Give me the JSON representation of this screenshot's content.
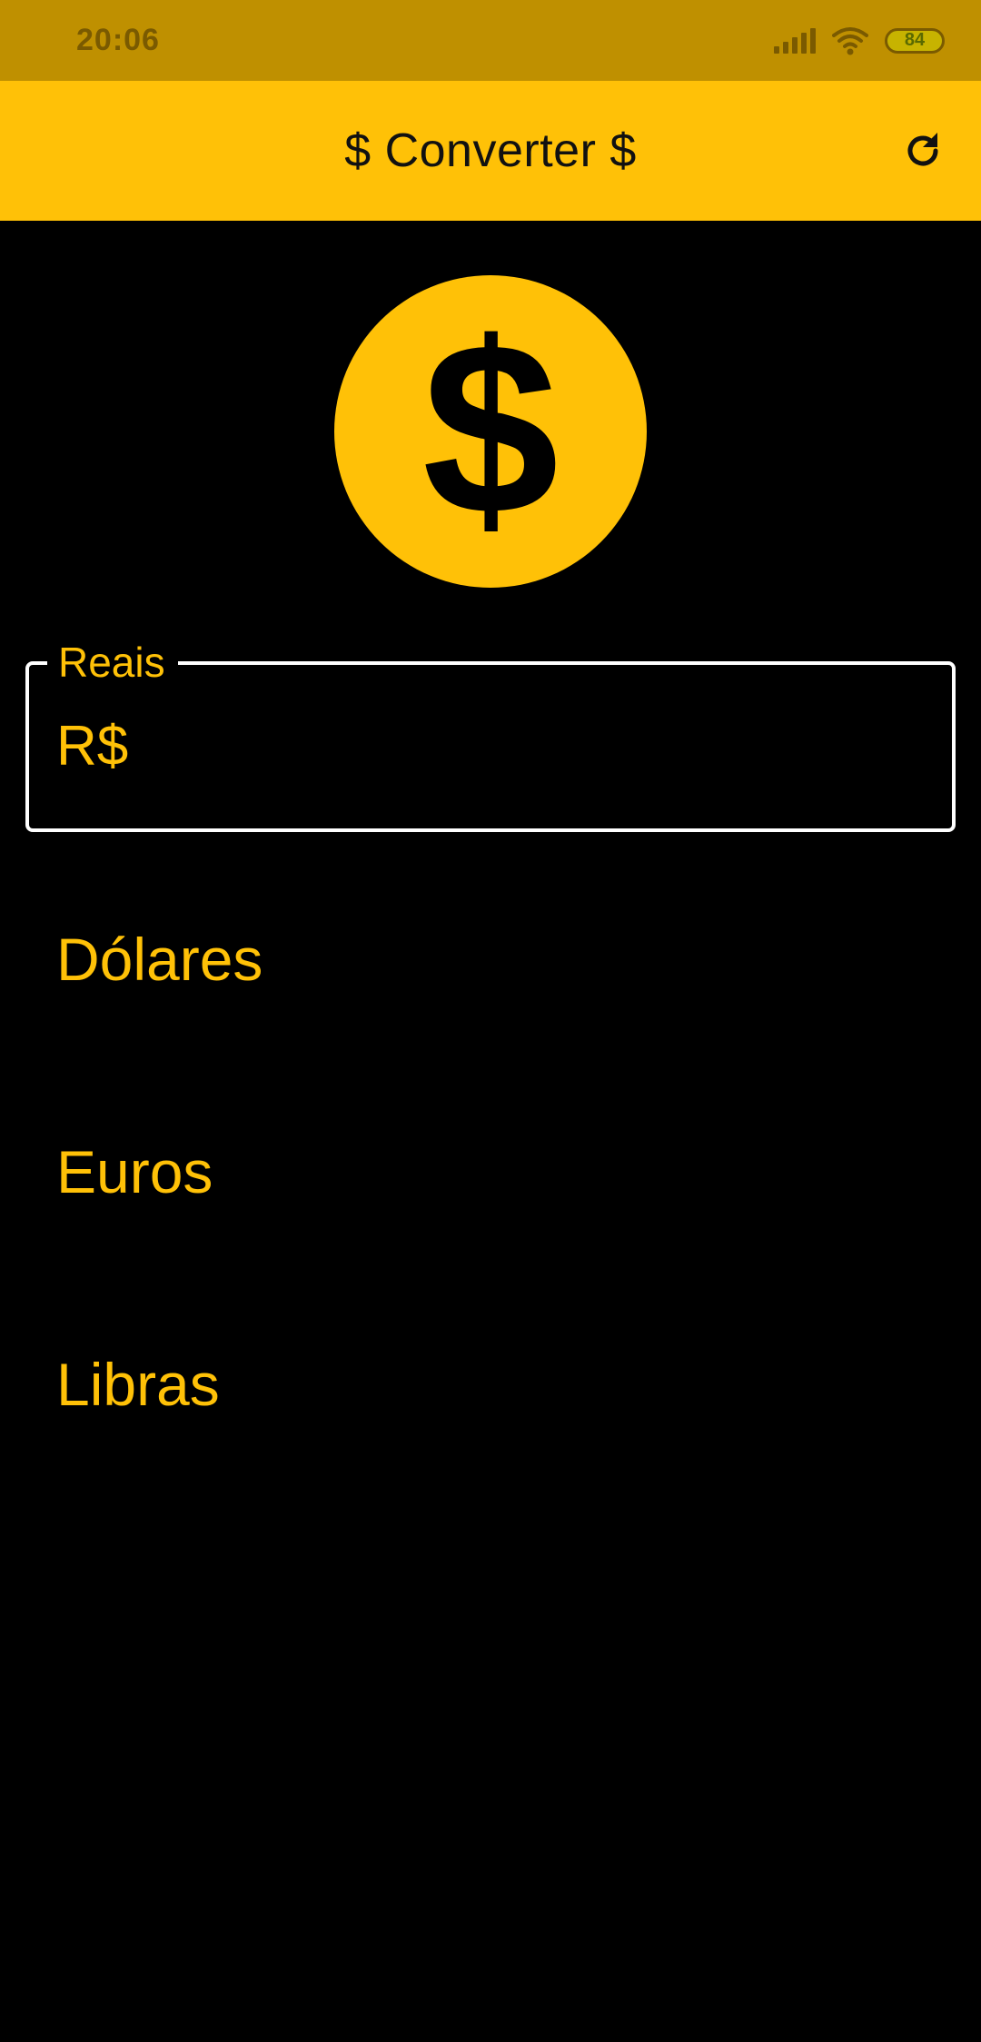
{
  "status_bar": {
    "time": "20:06",
    "battery_level": "84",
    "icons": [
      "signal-icon",
      "wifi-icon",
      "battery-icon"
    ]
  },
  "app_bar": {
    "title": "$ Converter $",
    "refresh_icon": "refresh-icon"
  },
  "main": {
    "hero_icon": "money-icon",
    "reais": {
      "label": "Reais",
      "prefix": "R$",
      "value": "",
      "placeholder": ""
    },
    "dolares": {
      "label": "Dólares"
    },
    "euros": {
      "label": "Euros"
    },
    "libras": {
      "label": "Libras"
    }
  },
  "colors": {
    "accent": "#FFC107",
    "status_bar": "#BF9000",
    "background": "#000000",
    "border": "#FFFFFF"
  }
}
